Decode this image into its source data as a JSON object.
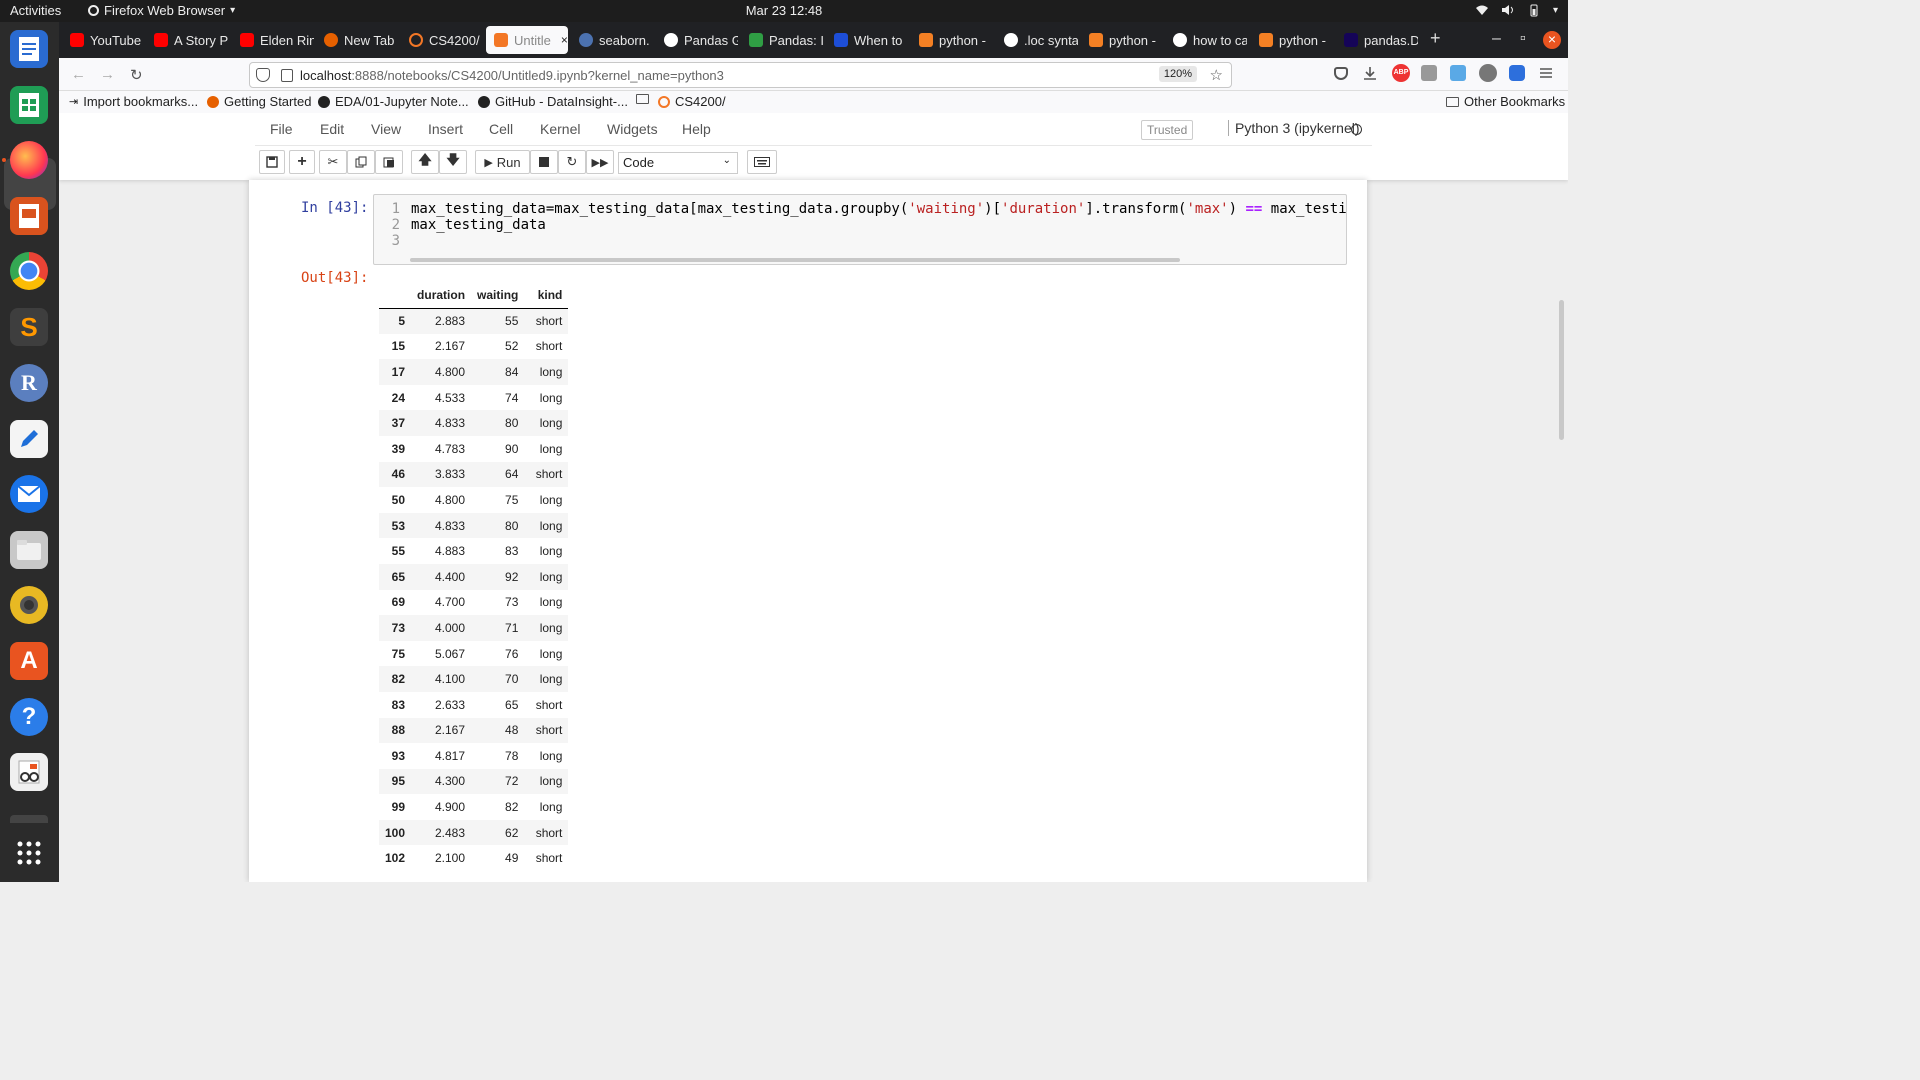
{
  "topbar": {
    "activities": "Activities",
    "app": "Firefox Web Browser",
    "app_arrow": "▾",
    "clock": "Mar 23  12:48"
  },
  "tabs": [
    {
      "label": "YouTube",
      "color": "#ff0000"
    },
    {
      "label": "A Story P",
      "color": "#ff0000"
    },
    {
      "label": "Elden Rin",
      "color": "#ff0000"
    },
    {
      "label": "New Tab",
      "color": "#e66000"
    },
    {
      "label": "CS4200/",
      "color": "#f37726"
    },
    {
      "label": "Untitle",
      "color": "#f37726"
    },
    {
      "label": "seaborn.",
      "color": "#4c72b0"
    },
    {
      "label": "Pandas G",
      "color": "#ffffff"
    },
    {
      "label": "Pandas: I",
      "color": "#2f9e44"
    },
    {
      "label": "When to",
      "color": "#1d4ed8"
    },
    {
      "label": "python -",
      "color": "#f48024"
    },
    {
      "label": ".loc synta",
      "color": "#ffffff"
    },
    {
      "label": "python -",
      "color": "#f48024"
    },
    {
      "label": "how to ca",
      "color": "#ffffff"
    },
    {
      "label": "python -",
      "color": "#f48024"
    },
    {
      "label": "pandas.D",
      "color": "#150458"
    }
  ],
  "tabstrip": {
    "new_tab": "+",
    "active_close": "×",
    "minimize": "–",
    "restore": "▫",
    "close": "×"
  },
  "navbar": {
    "back": "←",
    "forward": "→",
    "reload": "↻",
    "url_host": "localhost",
    "url_rest": ":8888/notebooks/CS4200/Untitled9.ipynb?kernel_name=python3",
    "zoom": "120%",
    "star": "☆"
  },
  "bookmarks": [
    {
      "label": "Import bookmarks..."
    },
    {
      "label": "Getting Started"
    },
    {
      "label": "EDA/01-Jupyter Note..."
    },
    {
      "label": "GitHub - DataInsight-..."
    },
    {
      "label": "CS4200/"
    }
  ],
  "other_bookmarks": "Other Bookmarks",
  "jupyter": {
    "menu": [
      "File",
      "Edit",
      "View",
      "Insert",
      "Cell",
      "Kernel",
      "Widgets",
      "Help"
    ],
    "trusted": "Trusted",
    "kernel": "Python 3 (ipykernel)",
    "run_label": "Run",
    "cell_type": "Code"
  },
  "cell": {
    "in_prompt": "In [43]:",
    "out_prompt": "Out[43]:",
    "line_numbers": [
      "1",
      "2",
      "3"
    ],
    "line1_a": "max_testing_data=max_testing_data[max_testing_data.groupby(",
    "line1_s1": "'waiting'",
    "line1_b": ")[",
    "line1_s2": "'duration'",
    "line1_c": "].transform(",
    "line1_s3": "'max'",
    "line1_d": ") ",
    "line1_op": "==",
    "line1_e": " max_testing",
    "line2": "max_testing_data"
  },
  "table": {
    "columns": [
      "duration",
      "waiting",
      "kind"
    ],
    "rows": [
      [
        "5",
        "2.883",
        "55",
        "short"
      ],
      [
        "15",
        "2.167",
        "52",
        "short"
      ],
      [
        "17",
        "4.800",
        "84",
        "long"
      ],
      [
        "24",
        "4.533",
        "74",
        "long"
      ],
      [
        "37",
        "4.833",
        "80",
        "long"
      ],
      [
        "39",
        "4.783",
        "90",
        "long"
      ],
      [
        "46",
        "3.833",
        "64",
        "short"
      ],
      [
        "50",
        "4.800",
        "75",
        "long"
      ],
      [
        "53",
        "4.833",
        "80",
        "long"
      ],
      [
        "55",
        "4.883",
        "83",
        "long"
      ],
      [
        "65",
        "4.400",
        "92",
        "long"
      ],
      [
        "69",
        "4.700",
        "73",
        "long"
      ],
      [
        "73",
        "4.000",
        "71",
        "long"
      ],
      [
        "75",
        "5.067",
        "76",
        "long"
      ],
      [
        "82",
        "4.100",
        "70",
        "long"
      ],
      [
        "83",
        "2.633",
        "65",
        "short"
      ],
      [
        "88",
        "2.167",
        "48",
        "short"
      ],
      [
        "93",
        "4.817",
        "78",
        "long"
      ],
      [
        "95",
        "4.300",
        "72",
        "long"
      ],
      [
        "99",
        "4.900",
        "82",
        "long"
      ],
      [
        "100",
        "2.483",
        "62",
        "short"
      ],
      [
        "102",
        "2.100",
        "49",
        "short"
      ]
    ]
  }
}
